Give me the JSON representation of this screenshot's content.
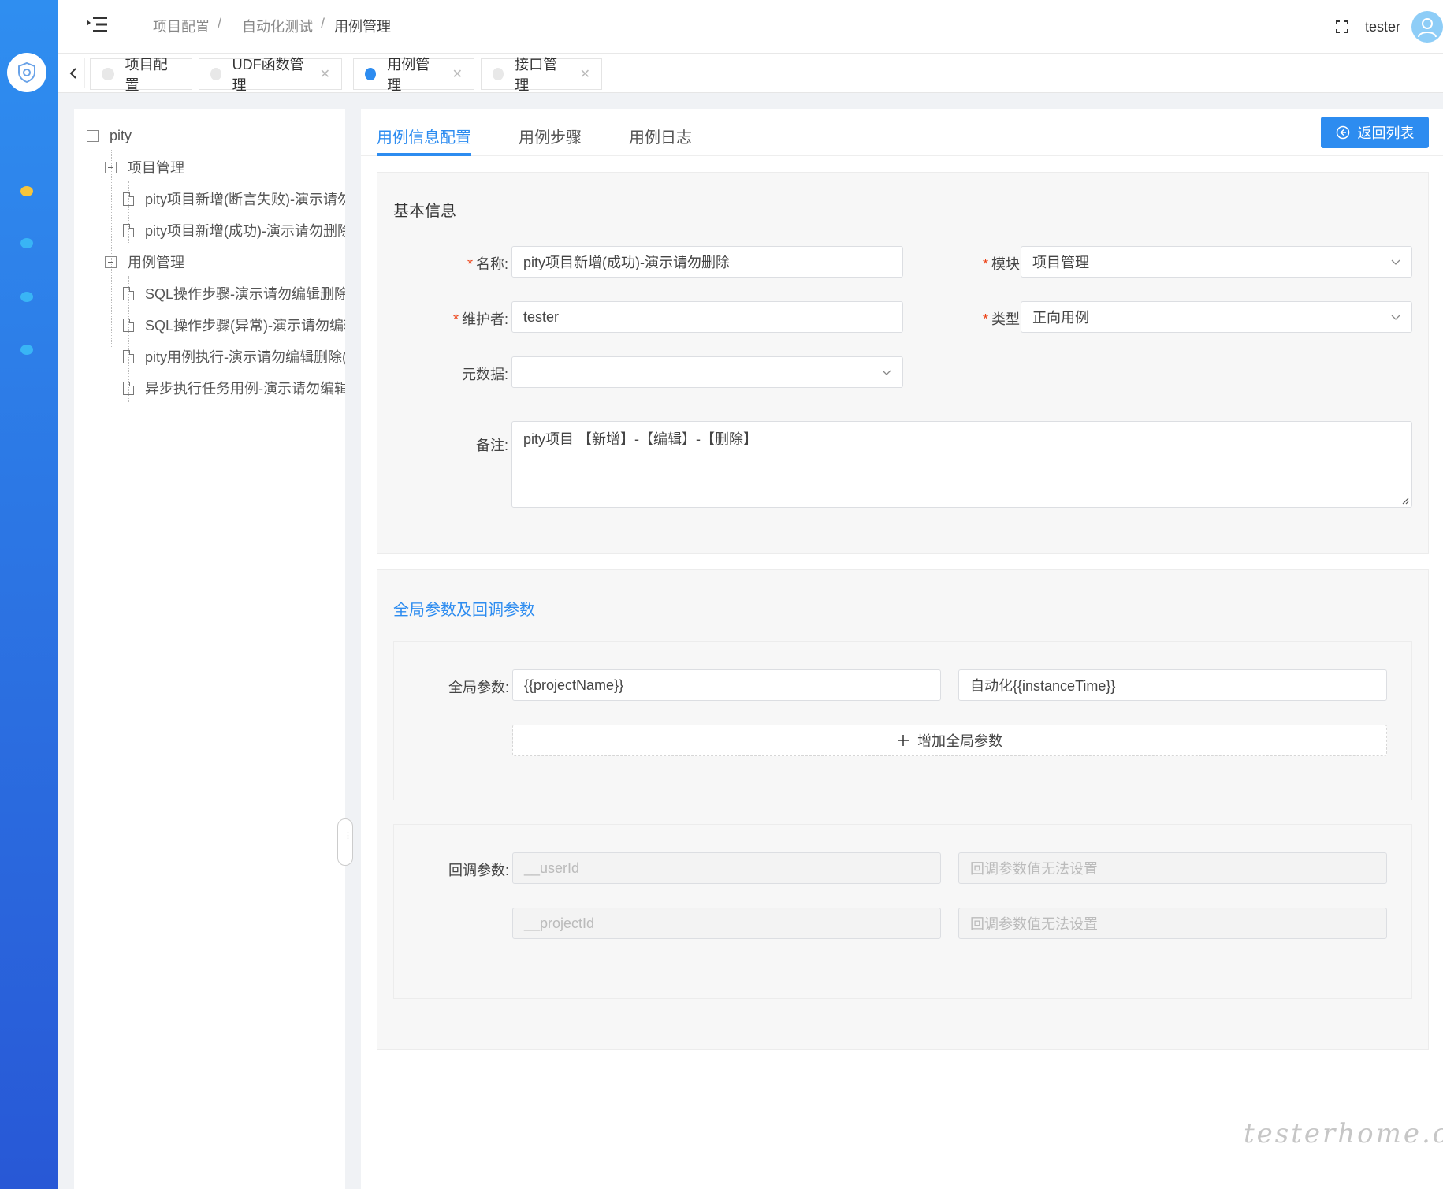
{
  "header": {
    "breadcrumb": [
      "项目配置",
      "自动化测试",
      "用例管理"
    ],
    "user_name": "tester"
  },
  "tabs": [
    {
      "label": "项目配置",
      "active": false,
      "closable": false
    },
    {
      "label": "UDF函数管理",
      "active": false,
      "closable": true
    },
    {
      "label": "用例管理",
      "active": true,
      "closable": true
    },
    {
      "label": "接口管理",
      "active": false,
      "closable": true
    }
  ],
  "tree": {
    "root": "pity",
    "groups": [
      {
        "label": "项目管理",
        "items": [
          "pity项目新增(断言失败)-演示请勿",
          "pity项目新增(成功)-演示请勿删除"
        ]
      },
      {
        "label": "用例管理",
        "items": [
          "SQL操作步骤-演示请勿编辑删除(",
          "SQL操作步骤(异常)-演示请勿编辑",
          "pity用例执行-演示请勿编辑删除(",
          "异步执行任务用例-演示请勿编辑"
        ]
      }
    ]
  },
  "main_tabs": [
    "用例信息配置",
    "用例步骤",
    "用例日志"
  ],
  "back_button": "返回列表",
  "basic_info": {
    "title": "基本信息",
    "name_label": "名称:",
    "name_value": "pity项目新增(成功)-演示请勿删除",
    "module_label": "模块:",
    "module_value": "项目管理",
    "owner_label": "维护者:",
    "owner_value": "tester",
    "type_label": "类型:",
    "type_value": "正向用例",
    "meta_label": "元数据:",
    "meta_value": "",
    "remark_label": "备注:",
    "remark_value": "pity项目 【新增】-【编辑】-【删除】"
  },
  "params": {
    "title": "全局参数及回调参数",
    "global_label": "全局参数:",
    "global_key": "{{projectName}}",
    "global_value": "自动化{{instanceTime}}",
    "add_global": "增加全局参数",
    "callback_label": "回调参数:",
    "callbacks": [
      {
        "key": "__userId",
        "value": "回调参数值无法设置"
      },
      {
        "key": "__projectId",
        "value": "回调参数值无法设置"
      }
    ]
  },
  "watermark": "testerhome.com",
  "colors": {
    "primary": "#2d8cf0",
    "rail": "#2b6ee0",
    "required": "#ed4014"
  }
}
